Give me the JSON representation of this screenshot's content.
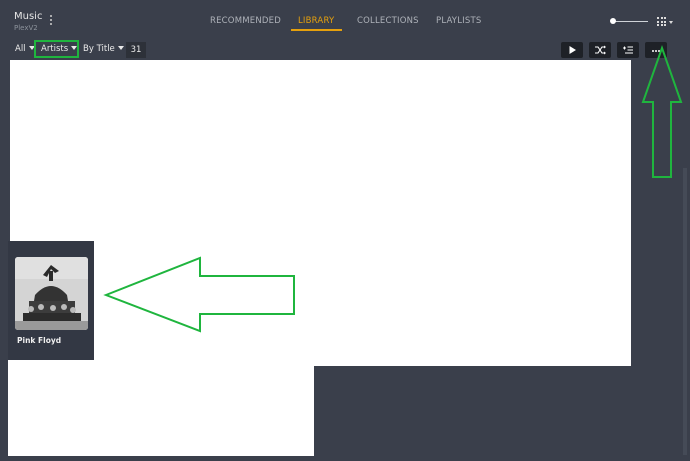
{
  "header": {
    "library_name": "Music",
    "server_name": "PlexV2"
  },
  "nav": {
    "tabs": [
      {
        "label": "RECOMMENDED",
        "active": false
      },
      {
        "label": "LIBRARY",
        "active": true
      },
      {
        "label": "COLLECTIONS",
        "active": false
      },
      {
        "label": "PLAYLISTS",
        "active": false
      }
    ]
  },
  "filters": {
    "scope": "All",
    "type": "Artists",
    "sort": "By Title",
    "count": "31"
  },
  "icons": {
    "menu": "vertical-dots-icon",
    "view": "grid-icon",
    "play": "play-icon",
    "shuffle": "shuffle-icon",
    "queue": "add-to-queue-icon",
    "more": "more-icon"
  },
  "items": [
    {
      "title": "Pink Floyd"
    }
  ],
  "colors": {
    "accent": "#e5a00d",
    "annotation": "#1fb53e",
    "background": "#3a3f4b"
  }
}
